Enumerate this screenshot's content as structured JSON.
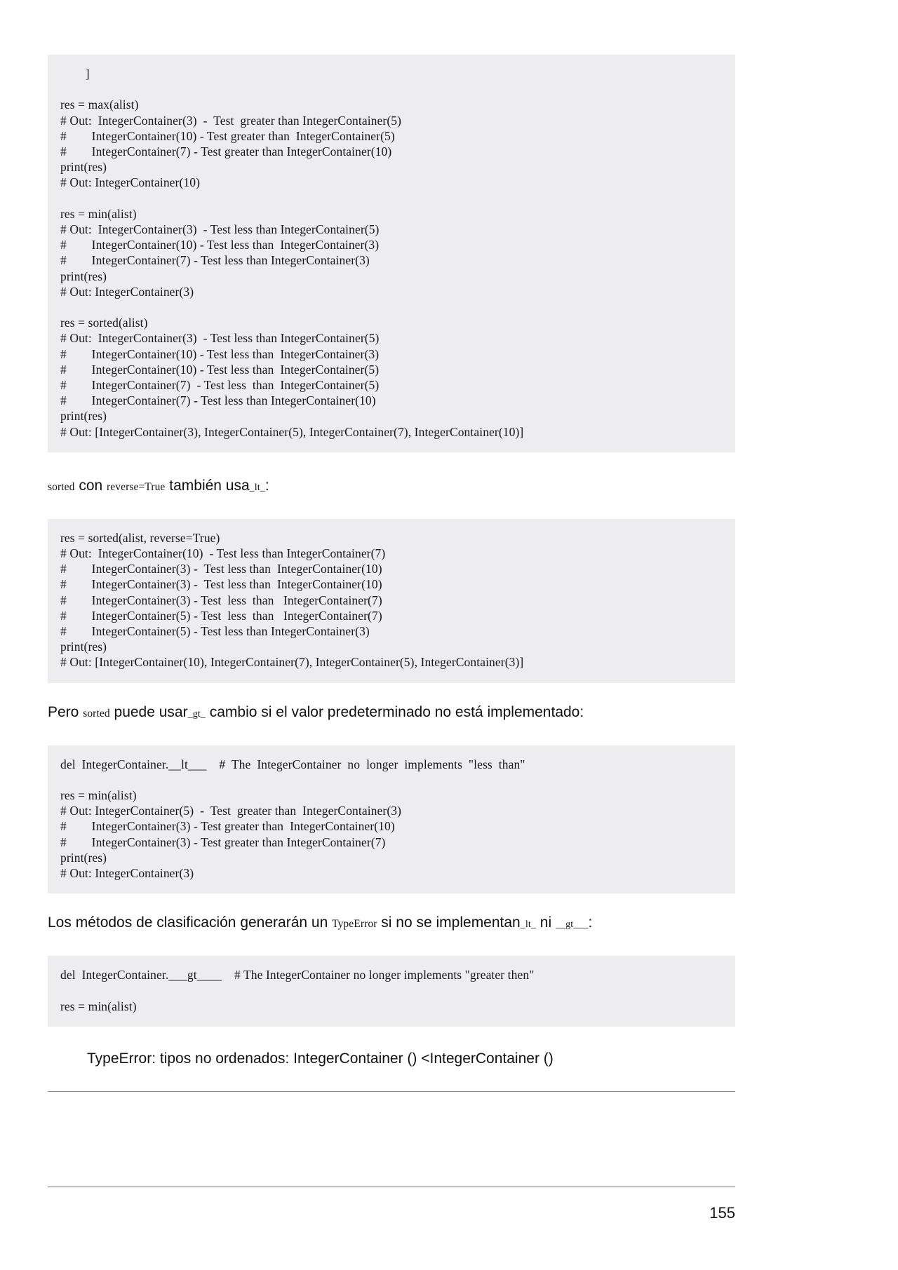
{
  "page": {
    "number": "155"
  },
  "blocks": {
    "code1": {
      "lines": [
        "        ]",
        "",
        "res = max(alist)",
        "# Out:  IntegerContainer(3)  -  Test  greater than IntegerContainer(5)",
        "#        IntegerContainer(10) - Test greater than  IntegerContainer(5)",
        "#        IntegerContainer(7) - Test greater than IntegerContainer(10)",
        "print(res)",
        "# Out: IntegerContainer(10)",
        "",
        "res = min(alist)",
        "# Out:  IntegerContainer(3)  - Test less than IntegerContainer(5)",
        "#        IntegerContainer(10) - Test less than  IntegerContainer(3)",
        "#        IntegerContainer(7) - Test less than IntegerContainer(3)",
        "print(res)",
        "# Out: IntegerContainer(3)",
        "",
        "res = sorted(alist)",
        "# Out:  IntegerContainer(3)  - Test less than IntegerContainer(5)",
        "#        IntegerContainer(10) - Test less than  IntegerContainer(3)",
        "#        IntegerContainer(10) - Test less than  IntegerContainer(5)",
        "#        IntegerContainer(7)  - Test less  than  IntegerContainer(5)",
        "#        IntegerContainer(7) - Test less than IntegerContainer(10)",
        "print(res)",
        "# Out: [IntegerContainer(3), IntegerContainer(5), IntegerContainer(7), IntegerContainer(10)]"
      ]
    },
    "code2": {
      "lines": [
        "res = sorted(alist, reverse=True)",
        "# Out:  IntegerContainer(10)  - Test less than IntegerContainer(7)",
        "#        IntegerContainer(3) -  Test less than  IntegerContainer(10)",
        "#        IntegerContainer(3) -  Test less than  IntegerContainer(10)",
        "#        IntegerContainer(3) - Test  less  than   IntegerContainer(7)",
        "#        IntegerContainer(5) - Test  less  than   IntegerContainer(7)",
        "#        IntegerContainer(5) - Test less than IntegerContainer(3)",
        "print(res)",
        "# Out: [IntegerContainer(10), IntegerContainer(7), IntegerContainer(5), IntegerContainer(3)]"
      ]
    },
    "code3": {
      "lines": [
        "del  IntegerContainer.__lt___    #  The  IntegerContainer  no  longer  implements  \"less  than\"",
        "",
        "res = min(alist)",
        "# Out: IntegerContainer(5)  -  Test  greater than  IntegerContainer(3)",
        "#        IntegerContainer(3) - Test greater than  IntegerContainer(10)",
        "#        IntegerContainer(3) - Test greater than IntegerContainer(7)",
        "print(res)",
        "# Out: IntegerContainer(3)"
      ]
    },
    "code4": {
      "lines": [
        "del  IntegerContainer.___gt____    # The IntegerContainer no longer implements \"greater then\"",
        "",
        "res = min(alist)"
      ]
    }
  },
  "paragraphs": {
    "p1": {
      "seg1": "sorted",
      "seg2": " con ",
      "seg3": "reverse=True",
      "seg4": " también usa",
      "seg5": "_lt_",
      "seg6": ":"
    },
    "p2": {
      "seg1": "Pero ",
      "seg2": "sorted",
      "seg3": " puede usar",
      "seg4": "_gt_",
      "seg5": " cambio si el valor predeterminado no está implementado:"
    },
    "p3": {
      "seg1": "Los métodos de clasificación generarán un ",
      "seg2": "TypeError",
      "seg3": " si no se implementan",
      "seg4": "_lt_",
      "seg5": " ni ",
      "seg6": "__gt___",
      "seg7": ":"
    }
  },
  "error": {
    "text": "TypeError: tipos no ordenados: IntegerContainer () <IntegerContainer ()"
  },
  "colors": {
    "code_background": "#ededf0",
    "text": "#111111",
    "rule": "#8a8a8a"
  }
}
